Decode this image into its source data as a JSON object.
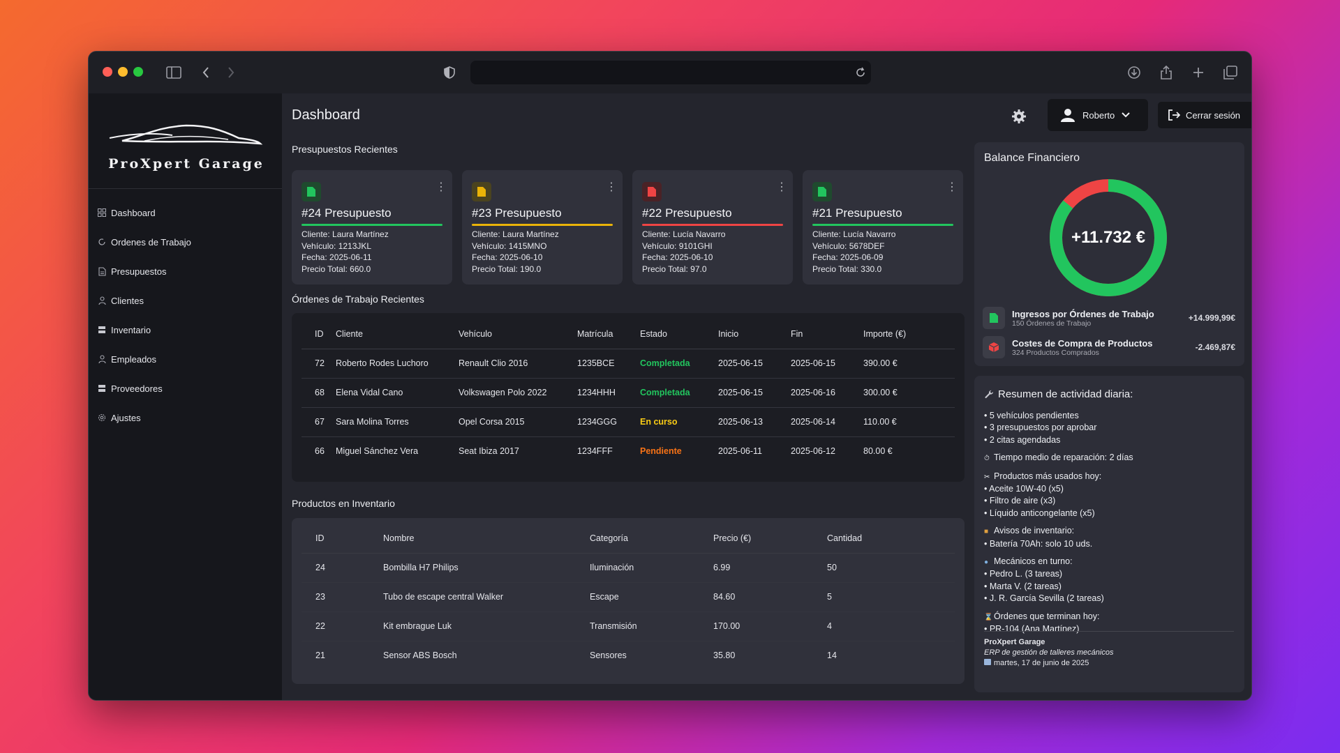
{
  "app": {
    "logo_text": "ProXpert Garage"
  },
  "header": {
    "page_title": "Dashboard",
    "user_name": "Roberto",
    "logout_label": "Cerrar sesión"
  },
  "sidebar": {
    "items": [
      {
        "label": "Dashboard",
        "icon": "grid-icon"
      },
      {
        "label": "Ordenes de Trabajo",
        "icon": "cycle-icon"
      },
      {
        "label": "Presupuestos",
        "icon": "document-icon"
      },
      {
        "label": "Clientes",
        "icon": "person-icon"
      },
      {
        "label": "Inventario",
        "icon": "boxes-icon"
      },
      {
        "label": "Empleados",
        "icon": "person-icon"
      },
      {
        "label": "Proveedores",
        "icon": "boxes-icon"
      },
      {
        "label": "Ajustes",
        "icon": "gear-icon"
      }
    ]
  },
  "presupuestos": {
    "title": "Presupuestos Recientes",
    "cards": [
      {
        "title": "#24 Presupuesto",
        "color": "#22c55e",
        "client": "Cliente: Laura Martínez",
        "vehicle": "Vehículo: 1213JKL",
        "date": "Fecha: 2025-06-11",
        "total": "Precio Total: 660.0"
      },
      {
        "title": "#23 Presupuesto",
        "color": "#eab308",
        "client": "Cliente: Laura Martínez",
        "vehicle": "Vehículo: 1415MNO",
        "date": "Fecha: 2025-06-10",
        "total": "Precio Total: 190.0"
      },
      {
        "title": "#22 Presupuesto",
        "color": "#ef4444",
        "client": "Cliente: Lucía Navarro",
        "vehicle": "Vehículo: 9101GHI",
        "date": "Fecha: 2025-06-10",
        "total": "Precio Total: 97.0"
      },
      {
        "title": "#21 Presupuesto",
        "color": "#22c55e",
        "client": "Cliente: Lucía Navarro",
        "vehicle": "Vehículo: 5678DEF",
        "date": "Fecha: 2025-06-09",
        "total": "Precio Total: 330.0"
      }
    ]
  },
  "ordenes": {
    "title": "Órdenes de Trabajo Recientes",
    "headers": [
      "ID",
      "Cliente",
      "Vehículo",
      "Matrícula",
      "Estado",
      "Inicio",
      "Fin",
      "Importe (€)"
    ],
    "rows": [
      {
        "id": "72",
        "client": "Roberto Rodes Luchoro",
        "vehicle": "Renault Clio 2016",
        "plate": "1235BCE",
        "status": "Completada",
        "start": "2025-06-15",
        "end": "2025-06-15",
        "amount": "390.00 €"
      },
      {
        "id": "68",
        "client": "Elena Vidal Cano",
        "vehicle": "Volkswagen Polo 2022",
        "plate": "1234HHH",
        "status": "Completada",
        "start": "2025-06-15",
        "end": "2025-06-16",
        "amount": "300.00 €"
      },
      {
        "id": "67",
        "client": "Sara Molina Torres",
        "vehicle": "Opel Corsa 2015",
        "plate": "1234GGG",
        "status": "En curso",
        "start": "2025-06-13",
        "end": "2025-06-14",
        "amount": "110.00 €"
      },
      {
        "id": "66",
        "client": "Miguel Sánchez Vera",
        "vehicle": "Seat Ibiza 2017",
        "plate": "1234FFF",
        "status": "Pendiente",
        "start": "2025-06-11",
        "end": "2025-06-12",
        "amount": "80.00 €"
      }
    ],
    "status_colors": {
      "Completada": "#22c55e",
      "En curso": "#facc15",
      "Pendiente": "#f97316"
    }
  },
  "inventario": {
    "title": "Productos en Inventario",
    "headers": [
      "ID",
      "Nombre",
      "Categoría",
      "Precio (€)",
      "Cantidad"
    ],
    "rows": [
      {
        "id": "24",
        "name": "Bombilla H7 Philips",
        "category": "Iluminación",
        "price": "6.99",
        "qty": "50"
      },
      {
        "id": "23",
        "name": "Tubo de escape central Walker",
        "category": "Escape",
        "price": "84.60",
        "qty": "5"
      },
      {
        "id": "22",
        "name": "Kit embrague Luk",
        "category": "Transmisión",
        "price": "170.00",
        "qty": "4"
      },
      {
        "id": "21",
        "name": "Sensor ABS Bosch",
        "category": "Sensores",
        "price": "35.80",
        "qty": "14"
      }
    ]
  },
  "balance": {
    "title": "Balance Financiero",
    "total": "+11.732 €",
    "income_fraction": 0.86,
    "income_color": "#22c55e",
    "expense_color": "#ef4444",
    "income_label": "Ingresos por Órdenes de Trabajo",
    "income_sub": "150 Órdenes de Trabajo",
    "income_amount": "+14.999,99€",
    "expense_label": "Costes de Compra de Productos",
    "expense_sub": "324 Productos Comprados",
    "expense_amount": "-2.469,87€"
  },
  "activity": {
    "title": "Resumen de actividad diaria:",
    "line1": "• 5 vehículos pendientes",
    "line2": "• 3 presupuestos por aprobar",
    "line3": "• 2 citas agendadas",
    "line4": "Tiempo medio de reparación: 2 días",
    "line5": "Productos más usados hoy:",
    "line6": "• Aceite 10W-40 (x5)",
    "line7": "• Filtro de aire (x3)",
    "line8": "• Líquido anticongelante (x5)",
    "line9": "Avisos de inventario:",
    "line10": "• Batería 70Ah: solo 10 uds.",
    "line11": "Mecánicos en turno:",
    "line12": "• Pedro L. (3 tareas)",
    "line13": "• Marta V. (2 tareas)",
    "line14": "• J. R. García Sevilla (2 tareas)",
    "line15": "Órdenes que terminan hoy:",
    "line16": "• PR-104 (Ana Martínez)",
    "footer_name": "ProXpert Garage",
    "footer_tagline": "ERP de gestión de talleres mecánicos",
    "footer_date": "martes, 17 de junio de 2025"
  }
}
